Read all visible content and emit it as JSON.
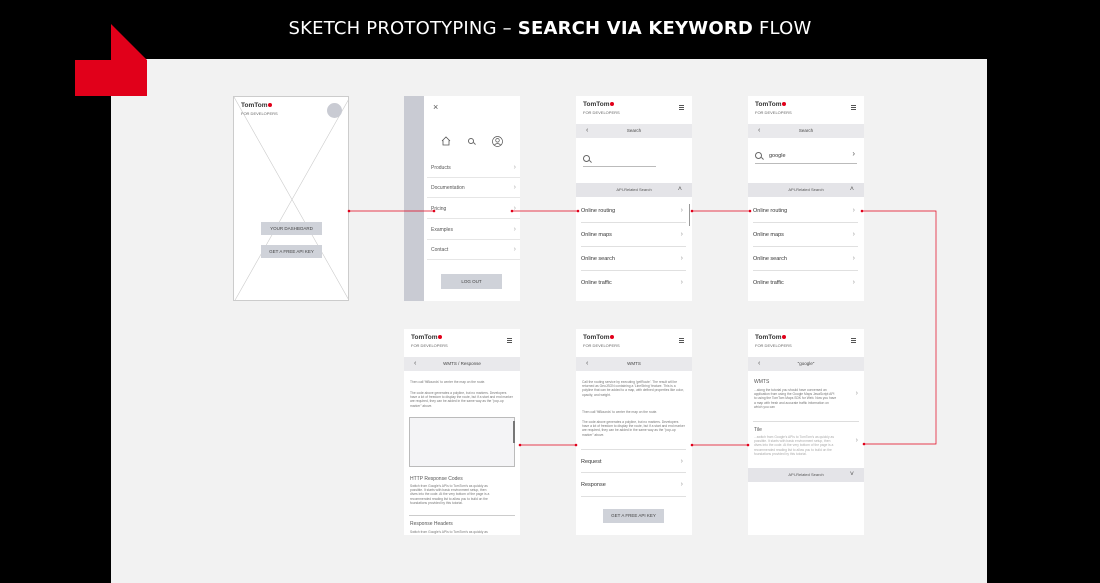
{
  "title": {
    "regular": "SKETCH PROTOTYPING –",
    "bold": "SEARCH VIA KEYWORD",
    "tail": "FLOW"
  },
  "brand": {
    "name": "TomTom",
    "sub": "FOR DEVELOPERS"
  },
  "colors": {
    "accent": "#e1001a",
    "canvas": "#f2f2f2"
  },
  "screen1": {
    "btn_dashboard": "YOUR DASHBOARD",
    "btn_api": "GET A FREE API KEY"
  },
  "screen2": {
    "close": "×",
    "menu": [
      "Products",
      "Documentation",
      "Pricing",
      "Examples",
      "Contact"
    ],
    "logout": "LOG OUT"
  },
  "screen3": {
    "bar": "Search",
    "band": "API-Related Search",
    "items": [
      "Online routing",
      "Online maps",
      "Online search",
      "Online traffic"
    ]
  },
  "screen4": {
    "bar": "Search",
    "query": "google",
    "band": "API-Related Search",
    "items": [
      "Online routing",
      "Online maps",
      "Online search",
      "Online traffic"
    ]
  },
  "screen5": {
    "bar": "WMTS / Response",
    "intro": "Then call 'fitBounds' to center the map on the route.",
    "p2": "The code above generates a polyline, but no markers. Developers have a lot of freedom to display the route, but if a start and end marker are required, they can be added in the same way as the \"pop-up marker\" above.",
    "h1": "HTTP Response Codes",
    "p3": "Switch from Google's APIs to TomTom's as quickly as possible. It starts with basic environment setup, then dives into the code. At the very bottom of the page is a recommended reading list to allow you to build on the foundations provided by this tutorial.",
    "h2": "Response Headers",
    "p4": "Switch from Google's APIs to TomTom's as quickly as"
  },
  "screen6": {
    "bar": "WMTS",
    "p1": "Call the routing service by executing 'getRoute'. The result will be returned as GeoJSON containing a 'LineString' feature. This is a polyline that can be added to a map, with defined properties like color, opacity, and weight.",
    "p2": "Then call 'fitBounds' to center the map on the route.",
    "p3": "The code above generates a polyline, but no markers. Developers have a lot of freedom to display the route, but if a start and end marker are required, they can be added in the same way as the \"pop-up marker\" above.",
    "items": [
      "Request",
      "Response"
    ],
    "btn": "GET A FREE API KEY"
  },
  "screen7": {
    "bar": "\"google\"",
    "r1_title": "WMTS",
    "r1_text": "...along the tutorial you should have conversed an application from using the Google Maps JavaScript API to using the TomTom Maps SDK for Web. Now you have a map with fresh and accurate traffic information on which you can",
    "r2_title": "Tile",
    "r2_text": "...switch from Google's APIs to TomTom's as quickly as possible. It starts with basic environment setup, then dives into the code. At the very bottom of the page is a recommended reading list to allow you to build on the foundations provided by this tutorial.",
    "band": "API-Related Search"
  }
}
